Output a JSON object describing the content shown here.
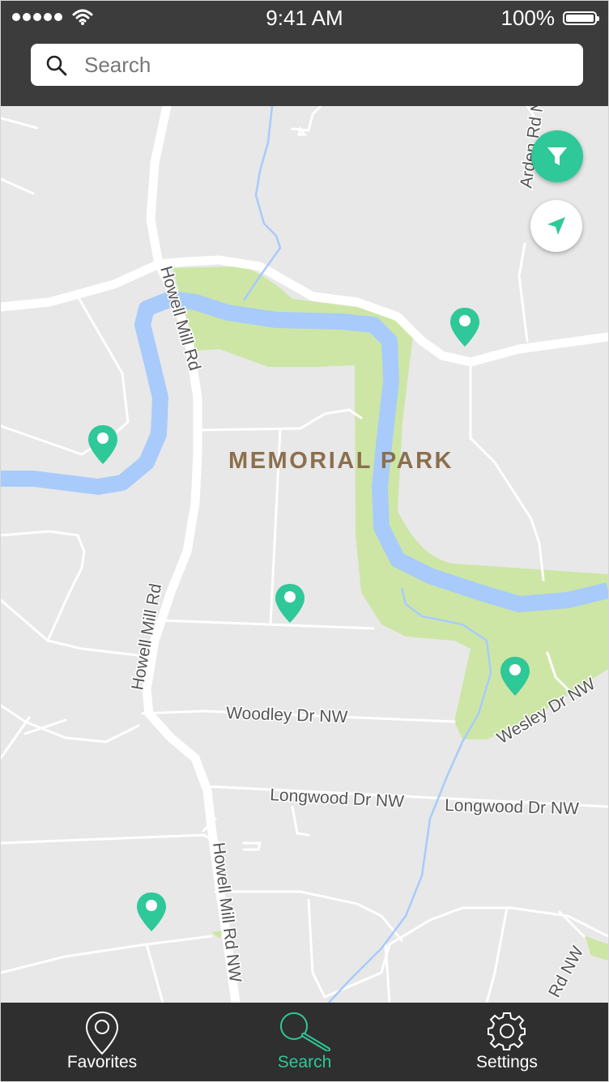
{
  "status_bar": {
    "time": "9:41 AM",
    "battery": "100%"
  },
  "search": {
    "placeholder": "Search",
    "value": ""
  },
  "map": {
    "park_label": "MEMORIAL PARK",
    "roads": [
      "Howell Mill Rd",
      "Howell Mill Rd",
      "Howell Mill Rd NW",
      "Woodley Dr NW",
      "Longwood Dr NW",
      "Longwood Dr NW",
      "Wesley Dr NW",
      "Arden Rd NW",
      "Rd NW"
    ]
  },
  "tabs": [
    {
      "label": "Favorites",
      "icon": "pin-outline-icon",
      "active": false
    },
    {
      "label": "Search",
      "icon": "search-icon",
      "active": true
    },
    {
      "label": "Settings",
      "icon": "gear-icon",
      "active": false
    }
  ],
  "colors": {
    "accent": "#2fc898",
    "header": "#3c3c3c",
    "tabbar": "#2f2f2f",
    "map_bg": "#e8e8e8",
    "park": "#cde6a6",
    "water": "#a8cbfb",
    "park_label": "#8b6f4e"
  }
}
